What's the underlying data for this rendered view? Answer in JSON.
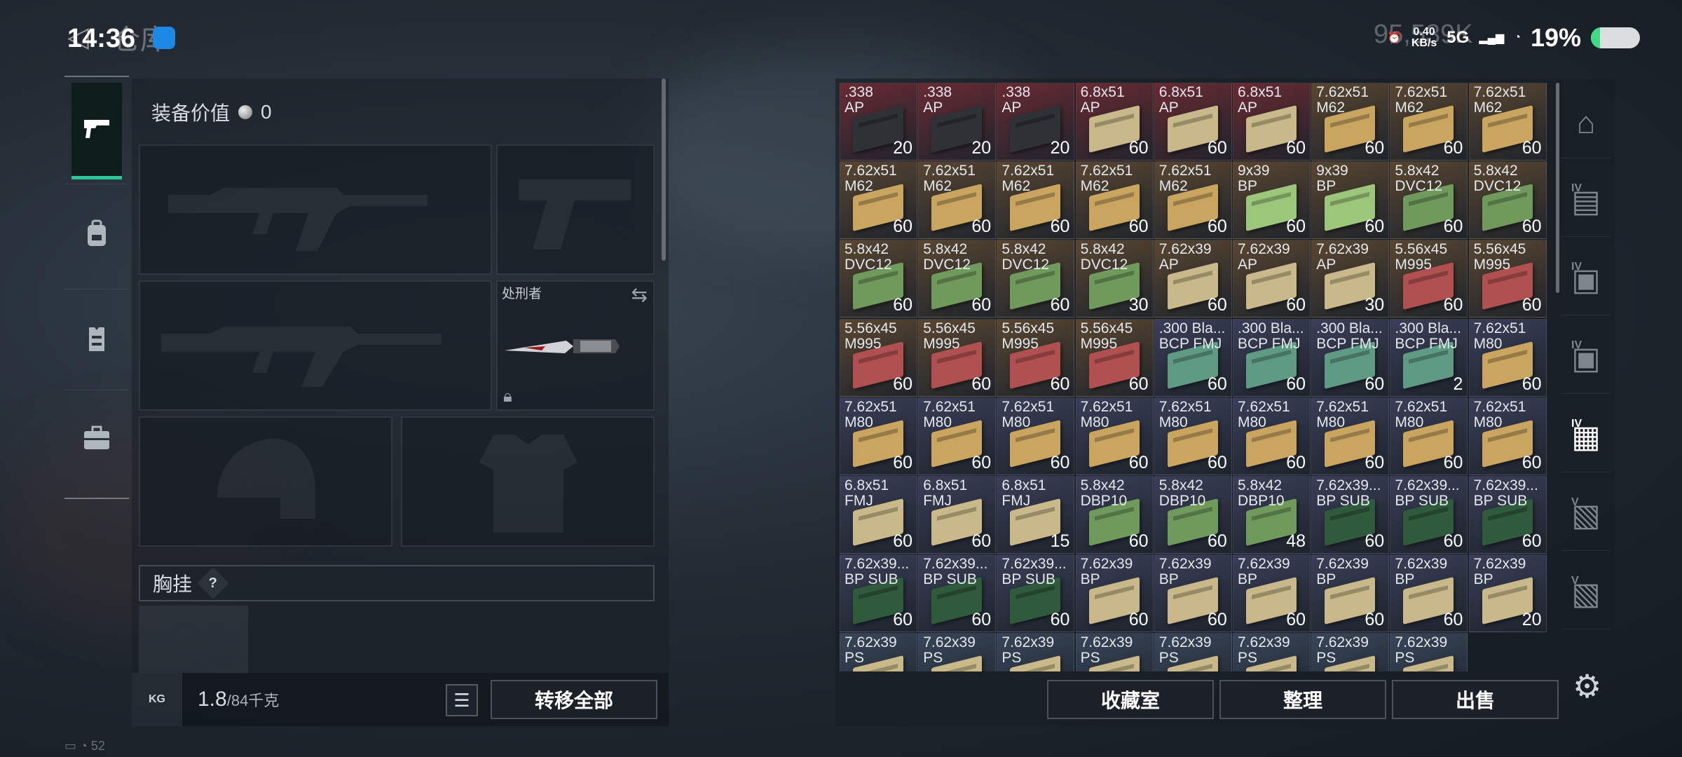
{
  "status_bar": {
    "time": "14:36",
    "title_ghost": "仓库",
    "currency_ghost": "95,539K",
    "speed_value": "0.40",
    "speed_unit": "KB/s",
    "network": "5G",
    "battery_percent": "19%",
    "battery_level": 0.19
  },
  "left_nav": {
    "items": [
      {
        "name": "weapons",
        "icon": "pistol-icon",
        "active": true
      },
      {
        "name": "backpack",
        "icon": "backpack-icon",
        "active": false
      },
      {
        "name": "rig",
        "icon": "vest-icon",
        "active": false
      },
      {
        "name": "case",
        "icon": "briefcase-icon",
        "active": false
      }
    ]
  },
  "equipment": {
    "value_label": "装备价值",
    "value": "0",
    "melee_name": "处刑者",
    "chest_label": "胸挂",
    "help": "?",
    "weight_current": "1.8",
    "weight_max": "/84千克",
    "kg_label": "KG",
    "transfer_all": "转移全部"
  },
  "stash": {
    "items": [
      {
        "name": ".338\nAP",
        "count": "20",
        "bg": "#6a2a32",
        "box": "#2e3236"
      },
      {
        "name": ".338\nAP",
        "count": "20",
        "bg": "#6a2a32",
        "box": "#2e3236"
      },
      {
        "name": ".338\nAP",
        "count": "20",
        "bg": "#6a2a32",
        "box": "#2e3236"
      },
      {
        "name": "6.8x51\nAP",
        "count": "60",
        "bg": "#6a2a32",
        "box": "#c8b88a"
      },
      {
        "name": "6.8x51\nAP",
        "count": "60",
        "bg": "#6a2a32",
        "box": "#c8b88a"
      },
      {
        "name": "6.8x51\nAP",
        "count": "60",
        "bg": "#6a2a32",
        "box": "#c8b88a"
      },
      {
        "name": "7.62x51\nM62",
        "count": "60",
        "bg": "#5a4630",
        "box": "#c9a560"
      },
      {
        "name": "7.62x51\nM62",
        "count": "60",
        "bg": "#5a4630",
        "box": "#c9a560"
      },
      {
        "name": "7.62x51\nM62",
        "count": "60",
        "bg": "#5a4630",
        "box": "#c9a560"
      },
      {
        "name": "7.62x51\nM62",
        "count": "60",
        "bg": "#5a4630",
        "box": "#c9a560"
      },
      {
        "name": "7.62x51\nM62",
        "count": "60",
        "bg": "#5a4630",
        "box": "#c9a560"
      },
      {
        "name": "7.62x51\nM62",
        "count": "60",
        "bg": "#5a4630",
        "box": "#c9a560"
      },
      {
        "name": "7.62x51\nM62",
        "count": "60",
        "bg": "#5a4630",
        "box": "#c9a560"
      },
      {
        "name": "7.62x51\nM62",
        "count": "60",
        "bg": "#5a4630",
        "box": "#c9a560"
      },
      {
        "name": "9x39\nBP",
        "count": "60",
        "bg": "#5a4630",
        "box": "#9cc77a"
      },
      {
        "name": "9x39\nBP",
        "count": "60",
        "bg": "#5a4630",
        "box": "#9cc77a"
      },
      {
        "name": "5.8x42\nDVC12",
        "count": "60",
        "bg": "#5a4630",
        "box": "#6f9a5c"
      },
      {
        "name": "5.8x42\nDVC12",
        "count": "60",
        "bg": "#5a4630",
        "box": "#6f9a5c"
      },
      {
        "name": "5.8x42\nDVC12",
        "count": "60",
        "bg": "#5a4630",
        "box": "#6f9a5c"
      },
      {
        "name": "5.8x42\nDVC12",
        "count": "60",
        "bg": "#5a4630",
        "box": "#6f9a5c"
      },
      {
        "name": "5.8x42\nDVC12",
        "count": "60",
        "bg": "#5a4630",
        "box": "#6f9a5c"
      },
      {
        "name": "5.8x42\nDVC12",
        "count": "30",
        "bg": "#5a4630",
        "box": "#6f9a5c"
      },
      {
        "name": "7.62x39\nAP",
        "count": "60",
        "bg": "#5a4630",
        "box": "#c8b88a"
      },
      {
        "name": "7.62x39\nAP",
        "count": "60",
        "bg": "#5a4630",
        "box": "#c8b88a"
      },
      {
        "name": "7.62x39\nAP",
        "count": "30",
        "bg": "#5a4630",
        "box": "#c8b88a"
      },
      {
        "name": "5.56x45\nM995",
        "count": "60",
        "bg": "#5a4630",
        "box": "#b05050"
      },
      {
        "name": "5.56x45\nM995",
        "count": "60",
        "bg": "#5a4630",
        "box": "#b05050"
      },
      {
        "name": "5.56x45\nM995",
        "count": "60",
        "bg": "#5a4630",
        "box": "#b05050"
      },
      {
        "name": "5.56x45\nM995",
        "count": "60",
        "bg": "#5a4630",
        "box": "#b05050"
      },
      {
        "name": "5.56x45\nM995",
        "count": "60",
        "bg": "#5a4630",
        "box": "#b05050"
      },
      {
        "name": "5.56x45\nM995",
        "count": "60",
        "bg": "#5a4630",
        "box": "#b05050"
      },
      {
        "name": ".300 Bla...\nBCP FMJ",
        "count": "60",
        "bg": "#3a3e58",
        "box": "#5f9a84"
      },
      {
        "name": ".300 Bla...\nBCP FMJ",
        "count": "60",
        "bg": "#3a3e58",
        "box": "#5f9a84"
      },
      {
        "name": ".300 Bla...\nBCP FMJ",
        "count": "60",
        "bg": "#3a3e58",
        "box": "#5f9a84"
      },
      {
        "name": ".300 Bla...\nBCP FMJ",
        "count": "2",
        "bg": "#3a3e58",
        "box": "#5f9a84"
      },
      {
        "name": "7.62x51\nM80",
        "count": "60",
        "bg": "#3a3e58",
        "box": "#c9a560"
      },
      {
        "name": "7.62x51\nM80",
        "count": "60",
        "bg": "#3a3e58",
        "box": "#c9a560"
      },
      {
        "name": "7.62x51\nM80",
        "count": "60",
        "bg": "#3a3e58",
        "box": "#c9a560"
      },
      {
        "name": "7.62x51\nM80",
        "count": "60",
        "bg": "#3a3e58",
        "box": "#c9a560"
      },
      {
        "name": "7.62x51\nM80",
        "count": "60",
        "bg": "#3a3e58",
        "box": "#c9a560"
      },
      {
        "name": "7.62x51\nM80",
        "count": "60",
        "bg": "#3a3e58",
        "box": "#c9a560"
      },
      {
        "name": "7.62x51\nM80",
        "count": "60",
        "bg": "#3a3e58",
        "box": "#c9a560"
      },
      {
        "name": "7.62x51\nM80",
        "count": "60",
        "bg": "#3a3e58",
        "box": "#c9a560"
      },
      {
        "name": "7.62x51\nM80",
        "count": "60",
        "bg": "#3a3e58",
        "box": "#c9a560"
      },
      {
        "name": "7.62x51\nM80",
        "count": "60",
        "bg": "#3a3e58",
        "box": "#c9a560"
      },
      {
        "name": "6.8x51\nFMJ",
        "count": "60",
        "bg": "#3a3e58",
        "box": "#c8b88a"
      },
      {
        "name": "6.8x51\nFMJ",
        "count": "60",
        "bg": "#3a3e58",
        "box": "#c8b88a"
      },
      {
        "name": "6.8x51\nFMJ",
        "count": "15",
        "bg": "#3a3e58",
        "box": "#c8b88a"
      },
      {
        "name": "5.8x42\nDBP10",
        "count": "60",
        "bg": "#3a3e58",
        "box": "#6f9a5c"
      },
      {
        "name": "5.8x42\nDBP10",
        "count": "60",
        "bg": "#3a3e58",
        "box": "#6f9a5c"
      },
      {
        "name": "5.8x42\nDBP10",
        "count": "48",
        "bg": "#3a3e58",
        "box": "#6f9a5c"
      },
      {
        "name": "7.62x39...\nBP SUB",
        "count": "60",
        "bg": "#3a3e58",
        "box": "#2f5a3c"
      },
      {
        "name": "7.62x39...\nBP SUB",
        "count": "60",
        "bg": "#3a3e58",
        "box": "#2f5a3c"
      },
      {
        "name": "7.62x39...\nBP SUB",
        "count": "60",
        "bg": "#3a3e58",
        "box": "#2f5a3c"
      },
      {
        "name": "7.62x39...\nBP SUB",
        "count": "60",
        "bg": "#3a3e58",
        "box": "#2f5a3c"
      },
      {
        "name": "7.62x39...\nBP SUB",
        "count": "60",
        "bg": "#3a3e58",
        "box": "#2f5a3c"
      },
      {
        "name": "7.62x39...\nBP SUB",
        "count": "60",
        "bg": "#3a3e58",
        "box": "#2f5a3c"
      },
      {
        "name": "7.62x39\nBP",
        "count": "60",
        "bg": "#3a3e58",
        "box": "#c8b88a"
      },
      {
        "name": "7.62x39\nBP",
        "count": "60",
        "bg": "#3a3e58",
        "box": "#c8b88a"
      },
      {
        "name": "7.62x39\nBP",
        "count": "60",
        "bg": "#3a3e58",
        "box": "#c8b88a"
      },
      {
        "name": "7.62x39\nBP",
        "count": "60",
        "bg": "#3a3e58",
        "box": "#c8b88a"
      },
      {
        "name": "7.62x39\nBP",
        "count": "60",
        "bg": "#3a3e58",
        "box": "#c8b88a"
      },
      {
        "name": "7.62x39\nBP",
        "count": "20",
        "bg": "#3a3e58",
        "box": "#c8b88a"
      },
      {
        "name": "7.62x39\nPS",
        "count": "",
        "bg": "#38465a",
        "box": "#c8b88a"
      },
      {
        "name": "7.62x39\nPS",
        "count": "",
        "bg": "#38465a",
        "box": "#c8b88a"
      },
      {
        "name": "7.62x39\nPS",
        "count": "",
        "bg": "#38465a",
        "box": "#c8b88a"
      },
      {
        "name": "7.62x39\nPS",
        "count": "",
        "bg": "#38465a",
        "box": "#c8b88a"
      },
      {
        "name": "7.62x39\nPS",
        "count": "",
        "bg": "#38465a",
        "box": "#c8b88a"
      },
      {
        "name": "7.62x39\nPS",
        "count": "",
        "bg": "#38465a",
        "box": "#c8b88a"
      },
      {
        "name": "7.62x39\nPS",
        "count": "",
        "bg": "#38465a",
        "box": "#c8b88a"
      },
      {
        "name": "7.62x39\nPS",
        "count": "",
        "bg": "#38465a",
        "box": "#c8b88a"
      }
    ],
    "buttons": {
      "collection": "收藏室",
      "organize": "整理",
      "sell": "出售"
    }
  },
  "right_tabs": {
    "items": [
      {
        "icon": "bunker-icon",
        "badge": ""
      },
      {
        "icon": "stash-tier-icon",
        "badge": "IV"
      },
      {
        "icon": "stash-add-icon",
        "badge": "IV"
      },
      {
        "icon": "stash-add-icon",
        "badge": "IV"
      },
      {
        "icon": "stash-folder-icon",
        "badge": "IV"
      },
      {
        "icon": "stash-locked-icon",
        "badge": "V"
      },
      {
        "icon": "stash-locked-icon",
        "badge": "V"
      }
    ]
  },
  "bottom_status": {
    "value": "52"
  }
}
